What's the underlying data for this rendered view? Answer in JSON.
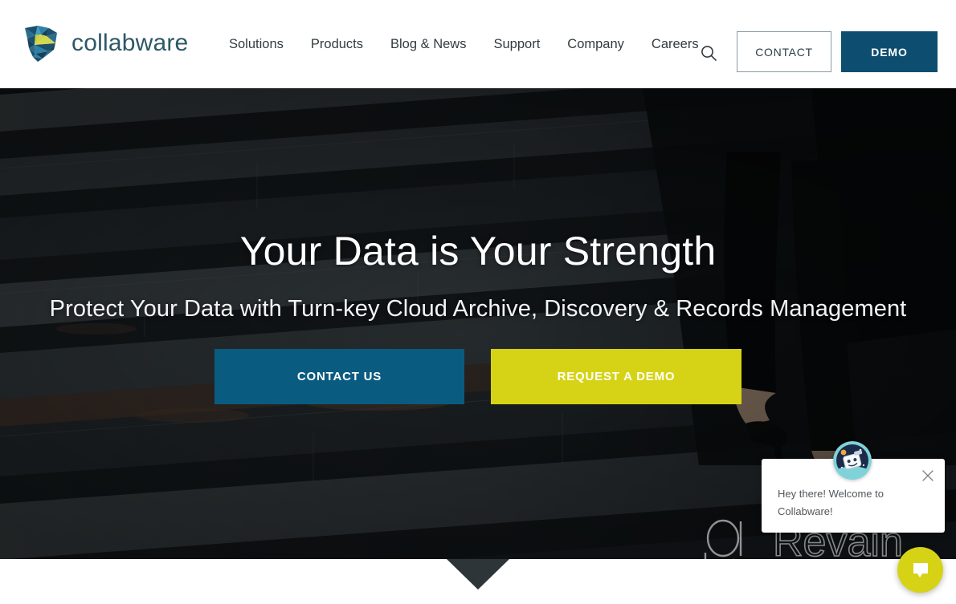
{
  "brand": {
    "name": "collabware",
    "logo_icon": "collabware-shield-logo",
    "wordmark_color": "#2d5866"
  },
  "header": {
    "nav_items": [
      {
        "label": "Solutions"
      },
      {
        "label": "Products"
      },
      {
        "label": "Blog & News"
      },
      {
        "label": "Support"
      },
      {
        "label": "Company"
      },
      {
        "label": "Careers"
      }
    ],
    "search_icon": "search-icon",
    "contact_label": "CONTACT",
    "demo_label": "DEMO",
    "contact_border_color": "#8b9aa3",
    "demo_bg_color": "#0d4d70"
  },
  "hero": {
    "title": "Your Data is Your Strength",
    "subtitle": "Protect Your Data with Turn-key Cloud Archive, Discovery & Records Management",
    "cta_primary": "CONTACT US",
    "cta_secondary": "REQUEST A DEMO",
    "cta_primary_color": "#0a5b80",
    "cta_secondary_color": "#d6d317",
    "background_description": "dark stone staircase with person walking up in black trousers and heels",
    "scroll_indicator_icon": "chevron-down-notch"
  },
  "chat": {
    "message": "Hey there! Welcome to Collabware!",
    "close_icon": "close-icon",
    "avatar_icon": "robot-astronaut-avatar",
    "launcher_icon": "chat-bubble-icon",
    "launcher_color": "#d6d317"
  },
  "watermark": {
    "text": "Revain",
    "logo_icon": "revain-logo-outline"
  }
}
